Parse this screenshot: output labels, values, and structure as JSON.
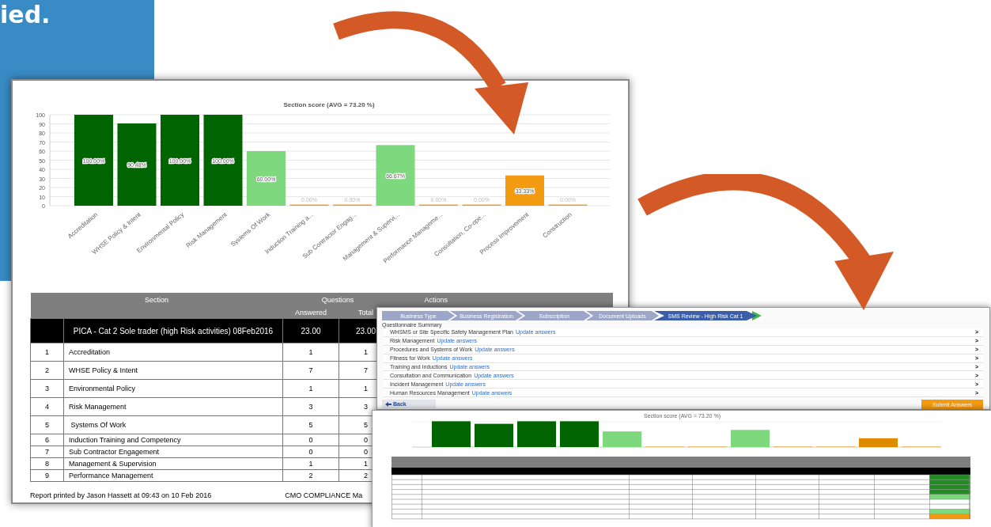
{
  "banner": {
    "text": "ied."
  },
  "report": {
    "chart": {
      "chart_data": {
        "type": "bar",
        "title": "Section score (AVG = 73.20 %)",
        "categories": [
          "Accreditation",
          "WHSE Policy & Intent",
          "Environmental Policy",
          "Risk Management",
          "Systems Of Work",
          "Induction Training a...",
          "Sub Contractor Engag...",
          "Management & Supervi...",
          "Performance Manageme...",
          "Consultation, Co-ope...",
          "Process Improvement",
          "Construction"
        ],
        "values": [
          100,
          90.48,
          100,
          100,
          60,
          0,
          0,
          66.67,
          0,
          0,
          33.33,
          0
        ],
        "value_labels": [
          "100.00%",
          "90.48%",
          "100.00%",
          "100.00%",
          "60.00%",
          "0.00%",
          "0.00%",
          "66.67%",
          "0.00%",
          "0.00%",
          "33.33%",
          "0.00%"
        ],
        "grid": true,
        "colors": [
          "#006400",
          "#006400",
          "#006400",
          "#006400",
          "#7ed87e",
          "#e8a030",
          "#e8a030",
          "#7ed87e",
          "#e8a030",
          "#e8a030",
          "#f39c12",
          "#e8a030"
        ],
        "ylim": [
          0,
          100
        ],
        "yticks": [
          0,
          10,
          20,
          30,
          40,
          50,
          60,
          70,
          80,
          90,
          100
        ],
        "data_labels": true
      }
    },
    "table": {
      "headers": {
        "section": "Section",
        "questions": "Questions",
        "actions": "Actions",
        "answered": "Answered",
        "total": "Total"
      },
      "summary": {
        "name": "PICA - Cat 2 Sole trader (high Risk activities) 08Feb2016",
        "answered": "23.00",
        "total": "23.00"
      },
      "rows": [
        {
          "no": "1",
          "section": "Accreditation",
          "answered": "1",
          "total": "1",
          "tall": true
        },
        {
          "no": "2",
          "section": "WHSE Policy & Intent",
          "answered": "7",
          "total": "7",
          "tall": true
        },
        {
          "no": "3",
          "section": "Environmental Policy",
          "answered": "1",
          "total": "1",
          "tall": true
        },
        {
          "no": "4",
          "section": "Risk Management",
          "answered": "3",
          "total": "3",
          "tall": true
        },
        {
          "no": "5",
          "section": " Systems Of Work",
          "answered": "5",
          "total": "5",
          "tall": true
        },
        {
          "no": "6",
          "section": "Induction Training and Competency",
          "answered": "0",
          "total": "0",
          "tall": false
        },
        {
          "no": "7",
          "section": "Sub Contractor Engagement",
          "answered": "0",
          "total": "0",
          "tall": false
        },
        {
          "no": "8",
          "section": "Management & Supervision",
          "answered": "1",
          "total": "1",
          "tall": false
        },
        {
          "no": "9",
          "section": "Performance Management",
          "answered": "2",
          "total": "2",
          "tall": false
        }
      ]
    },
    "footer": {
      "printed": "Report printed by Jason Hassett at 09:43 on 10 Feb 2016",
      "company": "CMO COMPLIANCE Ma"
    }
  },
  "wizard": {
    "steps": [
      {
        "label": "Business Type",
        "selected": false
      },
      {
        "label": "Business Registration",
        "selected": false
      },
      {
        "label": "Subscription",
        "selected": false
      },
      {
        "label": "Document Uploads",
        "selected": false
      },
      {
        "label": "SMS Review - High Risk Cat 1",
        "selected": true
      }
    ],
    "heading": "Questionnaire Summary",
    "items": [
      {
        "name": "WHSMS or Site Specific Safety Management Plan",
        "link": "Update answers",
        "chevron": ">"
      },
      {
        "name": "Risk Management",
        "link": "Update answers",
        "chevron": ">"
      },
      {
        "name": "Procedures and Systems of Work",
        "link": "Update answers",
        "chevron": ">"
      },
      {
        "name": "Fitness for Work",
        "link": "Update answers",
        "chevron": ">"
      },
      {
        "name": "Training and Inductions",
        "link": "Update answers",
        "chevron": ">"
      },
      {
        "name": "Consultation and Communication",
        "link": "Update answers",
        "chevron": ">"
      },
      {
        "name": "Incident Management",
        "link": "Update answers",
        "chevron": ">"
      },
      {
        "name": "Human Resources Management",
        "link": "Update answers",
        "chevron": ">"
      }
    ],
    "back": "Back",
    "submit": "Submit Answers"
  },
  "mini_report": {
    "title": "Section score (AVG = 73.20 %)"
  }
}
